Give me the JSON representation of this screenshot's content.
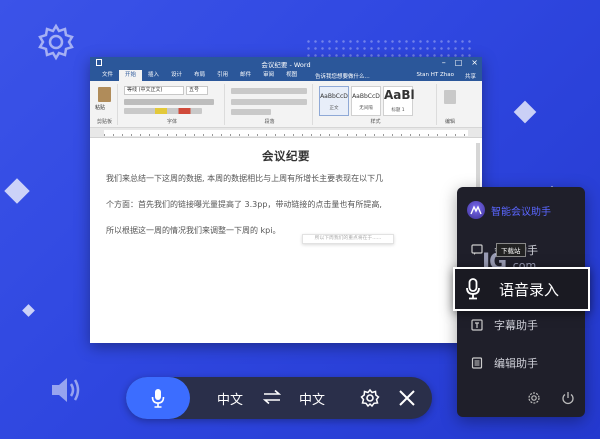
{
  "word": {
    "title": "会议纪要 - Word",
    "tabs": [
      "文件",
      "开始",
      "插入",
      "设计",
      "布局",
      "引用",
      "邮件",
      "审阅",
      "视图"
    ],
    "active_tab": "开始",
    "tell_me": "告诉我您想要做什么...",
    "user": "Stan HT Zhao",
    "share": "共享",
    "font_name": "等线 (中文正文)",
    "font_size": "五号",
    "group_labels": [
      "剪贴板",
      "字体",
      "段落",
      "样式",
      "编辑"
    ],
    "styles": [
      {
        "sample": "AaBbCcD",
        "name": "正文"
      },
      {
        "sample": "AaBbCcD",
        "name": "无间隔"
      },
      {
        "sample": "AaBl",
        "name": "标题 1"
      }
    ],
    "paste": "粘贴",
    "doc_heading": "会议纪要",
    "line1": "我们来总结一下这周的数据, 本周的数据相比与上周有所增长主要表现在以下几",
    "line2": "个方面：首先我们的链接曝光量提高了 3.3pp，带动链接的点击量也有所提高,",
    "line3": "所以根据这一周的情况我们来调整一下周的 kpi。",
    "tooltip": "所以下周我们的重点将在于......"
  },
  "panel": {
    "title": "智能会议助手",
    "items": [
      {
        "label": "会议助手",
        "icon": "chat-icon"
      },
      {
        "label": "语音录入",
        "icon": "mic-icon"
      },
      {
        "label": "字幕助手",
        "icon": "subtitle-icon"
      },
      {
        "label": "编辑助手",
        "icon": "document-icon"
      }
    ]
  },
  "watermark": {
    "text": "JG",
    "suffix": ".com",
    "tag": "下载站"
  },
  "bar": {
    "source_lang": "中文",
    "target_lang": "中文"
  },
  "colors": {
    "background": "#3349e4",
    "word_blue": "#2b579a",
    "accent": "#3c6dff",
    "panel_bg": "#1f1f2a",
    "panel_title": "#5a66ff"
  }
}
